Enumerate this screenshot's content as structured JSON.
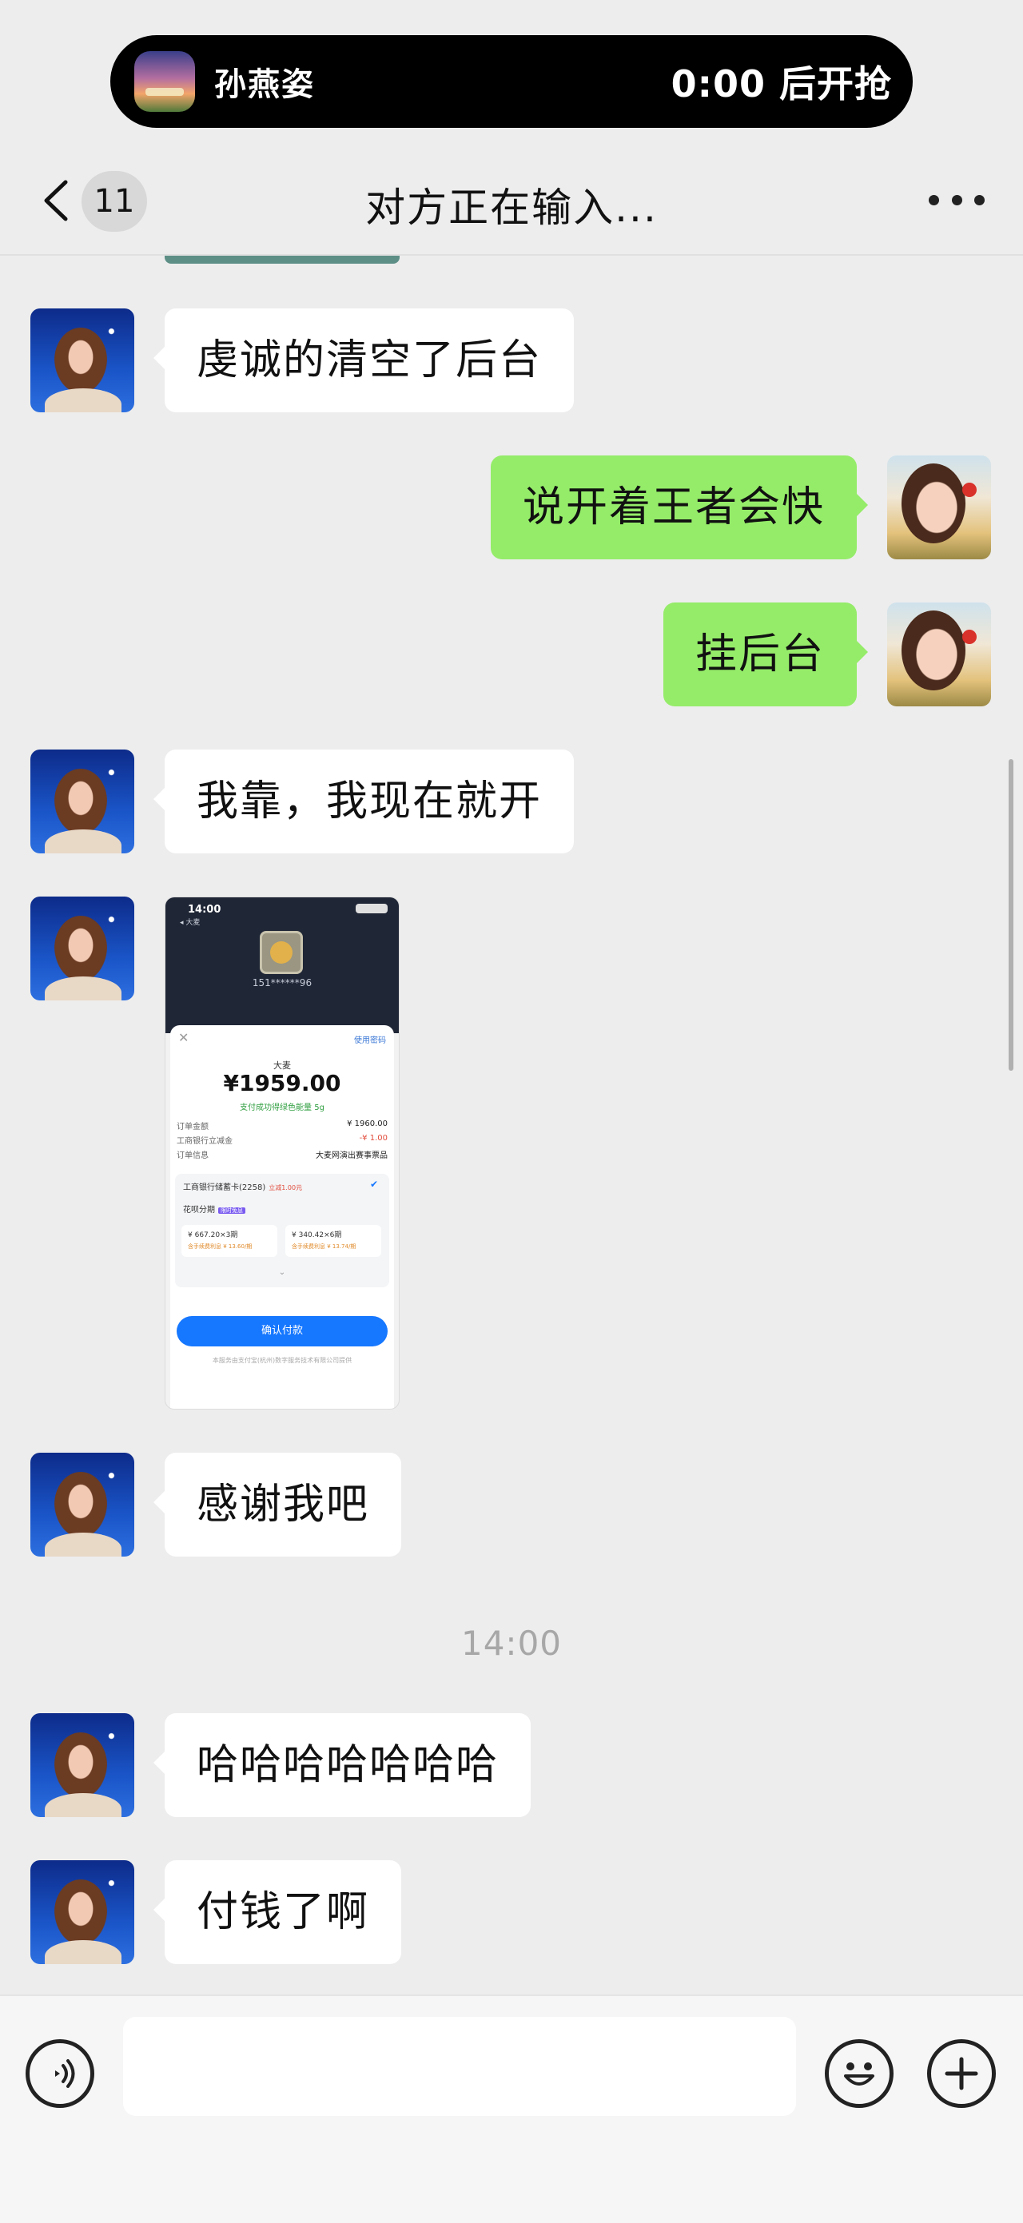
{
  "island": {
    "app_icon": "ticket-app-icon",
    "name": "孙燕姿",
    "timer": "0:00 后开抢"
  },
  "nav": {
    "back_icon": "chevron-left-icon",
    "unread_count": "11",
    "title": "对方正在输入...",
    "more_icon": "ellipsis-icon"
  },
  "messages": [
    {
      "side": "in",
      "text": "虔诚的清空了后台"
    },
    {
      "side": "out",
      "text": "说开着王者会快"
    },
    {
      "side": "out",
      "text": "挂后台"
    },
    {
      "side": "in",
      "text": "我靠，我现在就开"
    },
    {
      "side": "in",
      "type": "image"
    },
    {
      "side": "in",
      "text": "感谢我吧"
    },
    {
      "type": "timestamp",
      "text": "14:00"
    },
    {
      "side": "in",
      "text": "哈哈哈哈哈哈哈"
    },
    {
      "side": "in",
      "text": "付钱了啊"
    }
  ],
  "screenshot": {
    "status_time": "14:00",
    "back_label": "◂ 大麦",
    "account": "151******96",
    "close": "✕",
    "use_password": "使用密码",
    "merchant": "大麦",
    "amount": "¥1959.00",
    "green_energy": "支付成功得绿色能量 5g",
    "rows": [
      {
        "label": "订单金额",
        "value": "¥ 1960.00"
      },
      {
        "label": "工商银行立减金",
        "value": "-¥ 1.00"
      },
      {
        "label": "订单信息",
        "value": "大麦网演出赛事票品"
      }
    ],
    "bank": "工商银行储蓄卡(2258)",
    "bank_tag": "立减1.00元",
    "huabei": "花呗分期",
    "huabei_tag": "限时免息",
    "plans": [
      {
        "main": "¥ 667.20×3期",
        "sub": "含手续费利息 ¥ 13.60/期"
      },
      {
        "main": "¥ 340.42×6期",
        "sub": "含手续费利息 ¥ 13.74/期"
      }
    ],
    "expand": "⌄",
    "confirm": "确认付款",
    "footer": "本服务由支付宝(杭州)数字服务技术有限公司提供"
  },
  "input_bar": {
    "voice_icon": "voice-icon",
    "input_value": "",
    "emoji_icon": "emoji-icon",
    "plus_icon": "plus-circle-icon"
  },
  "colors": {
    "background": "#ededed",
    "incoming_bubble": "#ffffff",
    "outgoing_bubble": "#95ec69",
    "pay_button": "#1677ff"
  }
}
